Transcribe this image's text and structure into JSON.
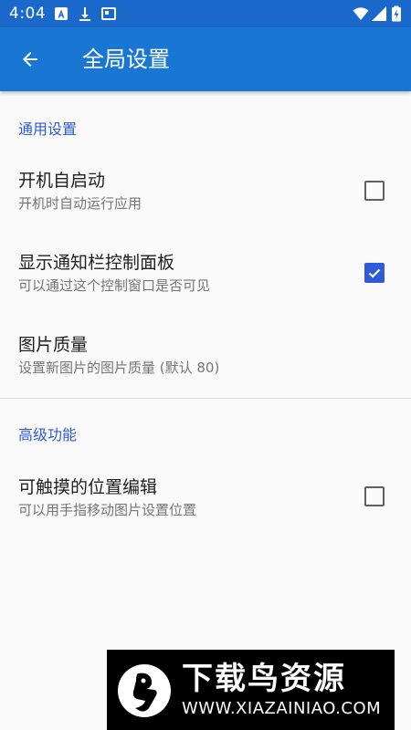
{
  "status_bar": {
    "time": "4:04",
    "icons": [
      "notification-a-icon",
      "download-icon",
      "image-icon",
      "wifi-icon",
      "signal-icon",
      "battery-icon"
    ]
  },
  "app_bar": {
    "title": "全局设置",
    "back_icon": "arrow-back-icon"
  },
  "sections": {
    "general": {
      "header": "通用设置",
      "items": [
        {
          "title": "开机自启动",
          "summary": "开机时自动运行应用",
          "checked": false
        },
        {
          "title": "显示通知栏控制面板",
          "summary": "可以通过这个控制窗口是否可见",
          "checked": true
        },
        {
          "title": "图片质量",
          "summary": "设置新图片的图片质量 (默认 80)"
        }
      ]
    },
    "advanced": {
      "header": "高级功能",
      "items": [
        {
          "title": "可触摸的位置编辑",
          "summary": "可以用手指移动图片设置位置",
          "checked": false
        }
      ]
    }
  },
  "watermark": {
    "name": "下载鸟资源",
    "url": "WWW.XIAZAINIAO.COM"
  },
  "colors": {
    "status_bar": "#1a68c9",
    "app_bar": "#1976d2",
    "accent": "#2f5ad8",
    "background": "#fafafa"
  }
}
